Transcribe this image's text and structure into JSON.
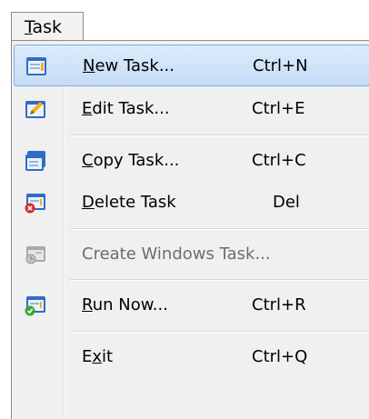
{
  "menubar": {
    "tab_label_first": "T",
    "tab_label_rest": "ask"
  },
  "menu": {
    "items": [
      {
        "mnemonic": "N",
        "rest": "ew Task...",
        "shortcut": "Ctrl+N",
        "icon": "new-task-icon"
      },
      {
        "mnemonic": "E",
        "rest": "dit Task...",
        "shortcut": "Ctrl+E",
        "icon": "edit-task-icon"
      },
      {
        "mnemonic": "C",
        "rest": "opy Task...",
        "shortcut": "Ctrl+C",
        "icon": "copy-task-icon"
      },
      {
        "mnemonic": "D",
        "rest": "elete Task",
        "shortcut": "Del",
        "icon": "delete-task-icon"
      },
      {
        "label": "Create Windows Task...",
        "icon": "windows-task-icon"
      },
      {
        "mnemonic": "R",
        "rest": "un Now...",
        "shortcut": "Ctrl+R",
        "icon": "run-now-icon"
      },
      {
        "pre": "E",
        "mnemonic": "x",
        "rest": "it",
        "shortcut": "Ctrl+Q"
      }
    ]
  },
  "colors": {
    "highlight_border": "#7fb1e6",
    "highlight_fill": "#c5dcf6",
    "disabled_text": "#6d6d6d"
  }
}
